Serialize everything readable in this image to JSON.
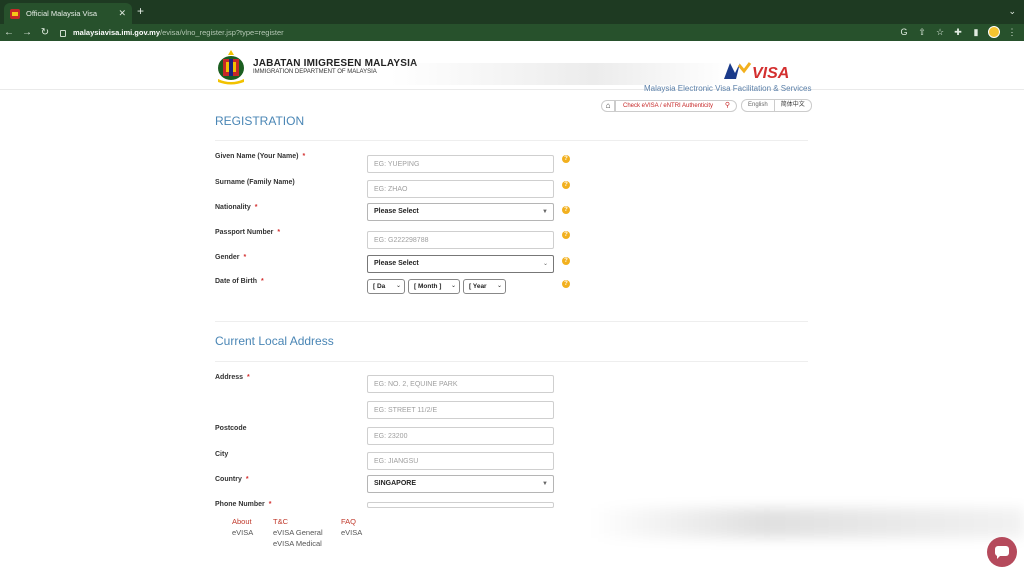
{
  "browser": {
    "tab_title": "Official Malaysia Visa",
    "tab_close": "✕",
    "new_tab": "+",
    "url_host": "malaysiavisa.imi.gov.my",
    "url_path": "/evisa/vlno_register.jsp?type=register"
  },
  "header": {
    "dept_name": "JABATAN IMIGRESEN MALAYSIA",
    "dept_name_en": "IMMIGRATION DEPARTMENT OF MALAYSIA",
    "logo_text": "MYVISA",
    "tagline": "Malaysia Electronic Visa Facilitation & Services"
  },
  "utility": {
    "check_label": "Check eVISA / eNTRI Authenticity",
    "lang_en": "English",
    "lang_zh": "简体中文"
  },
  "registration": {
    "title": "REGISTRATION",
    "given_name_label": "Given Name (Your Name)",
    "given_name_placeholder": "EG: YUEPING",
    "surname_label": "Surname (Family Name)",
    "surname_placeholder": "EG: ZHAO",
    "nationality_label": "Nationality",
    "nationality_value": "Please Select",
    "passport_label": "Passport Number",
    "passport_placeholder": "EG: G222298788",
    "gender_label": "Gender",
    "gender_value": "Please Select",
    "dob_label": "Date of Birth",
    "dob_day": "[ Da",
    "dob_month": "[ Month ]",
    "dob_year": "[ Year"
  },
  "address": {
    "title": "Current Local Address",
    "address_label": "Address",
    "line1_placeholder": "EG: NO. 2, EQUINE PARK",
    "line2_placeholder": "EG: STREET 11/2/E",
    "postcode_label": "Postcode",
    "postcode_placeholder": "EG: 23200",
    "city_label": "City",
    "city_placeholder": "EG: JIANGSU",
    "country_label": "Country",
    "country_value": "SINGAPORE",
    "phone_label": "Phone Number"
  },
  "footer": {
    "col1_head": "About",
    "col1_items": [
      "eVISA"
    ],
    "col2_head": "T&C",
    "col2_items": [
      "eVISA General",
      "eVISA Medical"
    ],
    "col3_head": "FAQ",
    "col3_items": [
      "eVISA"
    ]
  },
  "colors": {
    "accent": "#4a86b5",
    "required": "#d32f2f",
    "help": "#f2b01e",
    "chrome": "#27512c"
  }
}
